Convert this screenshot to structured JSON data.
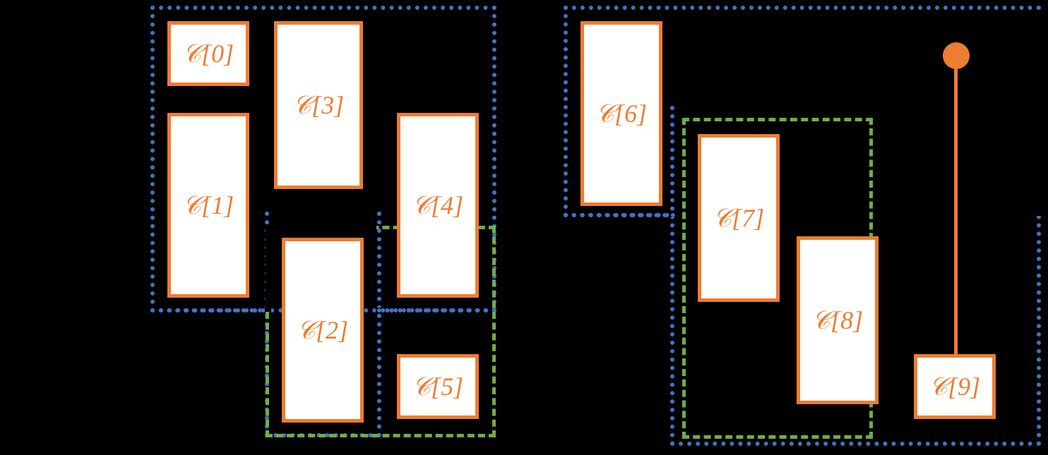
{
  "labels": {
    "c0": "𝒞[0]",
    "c1": "𝒞[1]",
    "c2": "𝒞[2]",
    "c3": "𝒞[3]",
    "c4": "𝒞[4]",
    "c5": "𝒞[5]",
    "c6": "𝒞[6]",
    "c7": "𝒞[7]",
    "c8": "𝒞[8]",
    "c9": "𝒞[9]"
  },
  "colors": {
    "orange": "#ed7d31",
    "blue": "#4472c4",
    "green": "#70ad47",
    "bg": "#000000",
    "box_fill": "#ffffff"
  },
  "diagram": {
    "description": "Column/cache layout diagram showing boxes C[0]..C[9] grouped by blue dotted regions and green dashed regions across two clusters, with a pin marker connecting to C[9].",
    "left_blue_group": [
      "c0",
      "c1",
      "c2",
      "c3",
      "c4"
    ],
    "left_green_group": [
      "c2",
      "c5"
    ],
    "right_blue_group": [
      "c6",
      "c7",
      "c8",
      "c9"
    ],
    "right_green_group": [
      "c7",
      "c8"
    ],
    "pin_target": "c9"
  }
}
